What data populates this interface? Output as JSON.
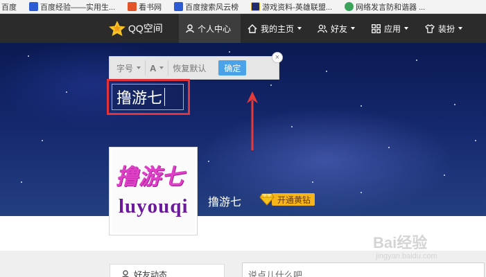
{
  "bookmarks": [
    {
      "label": "百度",
      "icon": "paw-icon"
    },
    {
      "label": "百度经验——实用生...",
      "icon": "paw-icon"
    },
    {
      "label": "看书网",
      "icon": "book-icon"
    },
    {
      "label": "百度搜索风云榜",
      "icon": "paw-icon"
    },
    {
      "label": "游戏资料-英雄联盟...",
      "icon": "game-icon"
    },
    {
      "label": "网络发言防和谐器 ...",
      "icon": "leaf-icon"
    }
  ],
  "nav": {
    "brand": "QQ空间",
    "items": [
      {
        "label": "个人中心",
        "icon": "person-icon",
        "active": true
      },
      {
        "label": "我的主页",
        "icon": "home-icon"
      },
      {
        "label": "好友",
        "icon": "friends-icon"
      },
      {
        "label": "应用",
        "icon": "apps-icon"
      },
      {
        "label": "装扮",
        "icon": "shirt-icon"
      }
    ]
  },
  "toolbar": {
    "font_size": "字号",
    "font_color": "A",
    "reset": "恢复默认",
    "confirm": "确定",
    "close": "×"
  },
  "title_edit": {
    "value": "撸游七"
  },
  "avatar": {
    "text_cn": "撸游七",
    "text_en": "luyouqi"
  },
  "profile": {
    "name": "撸游七",
    "vip_label": "开通黄钻"
  },
  "feed": {
    "tab_label": "好友动态",
    "input_placeholder": "说点儿什么吧"
  },
  "watermark": {
    "main": "Bai经验",
    "sub": "jingyan.baidu.com"
  },
  "colors": {
    "accent": "#4aa3e8",
    "highlight": "#e0333a",
    "vip": "#f5b51a"
  }
}
